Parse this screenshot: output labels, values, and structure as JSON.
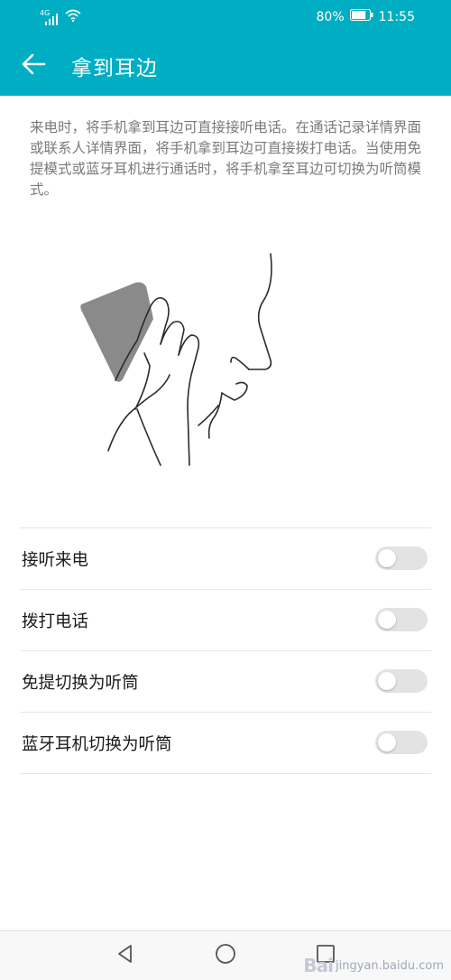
{
  "status_bar": {
    "network_label": "4G",
    "battery_percent": "80%",
    "battery_level": 0.8,
    "time": "11:55",
    "icons": [
      "signal-icon",
      "wifi-icon",
      "battery-icon"
    ]
  },
  "app_bar": {
    "title": "拿到耳边",
    "back_icon": "arrow-left-icon",
    "background_color": "#00aec4"
  },
  "description": "来电时，将手机拿到耳边可直接接听电话。在通话记录详情界面或联系人详情界面，将手机拿到耳边可直接拨打电话。当使用免提模式或蓝牙耳机进行通话时，将手机拿至耳边可切换为听筒模式。",
  "settings": [
    {
      "label": "接听来电",
      "enabled": false
    },
    {
      "label": "拨打电话",
      "enabled": false
    },
    {
      "label": "免提切换为听筒",
      "enabled": false
    },
    {
      "label": "蓝牙耳机切换为听筒",
      "enabled": false
    }
  ],
  "nav_bar": {
    "buttons": [
      "back-triangle-icon",
      "home-circle-icon",
      "recents-square-icon"
    ]
  },
  "watermark": {
    "brand": "Bai",
    "text": "jingyan.baidu.com"
  }
}
